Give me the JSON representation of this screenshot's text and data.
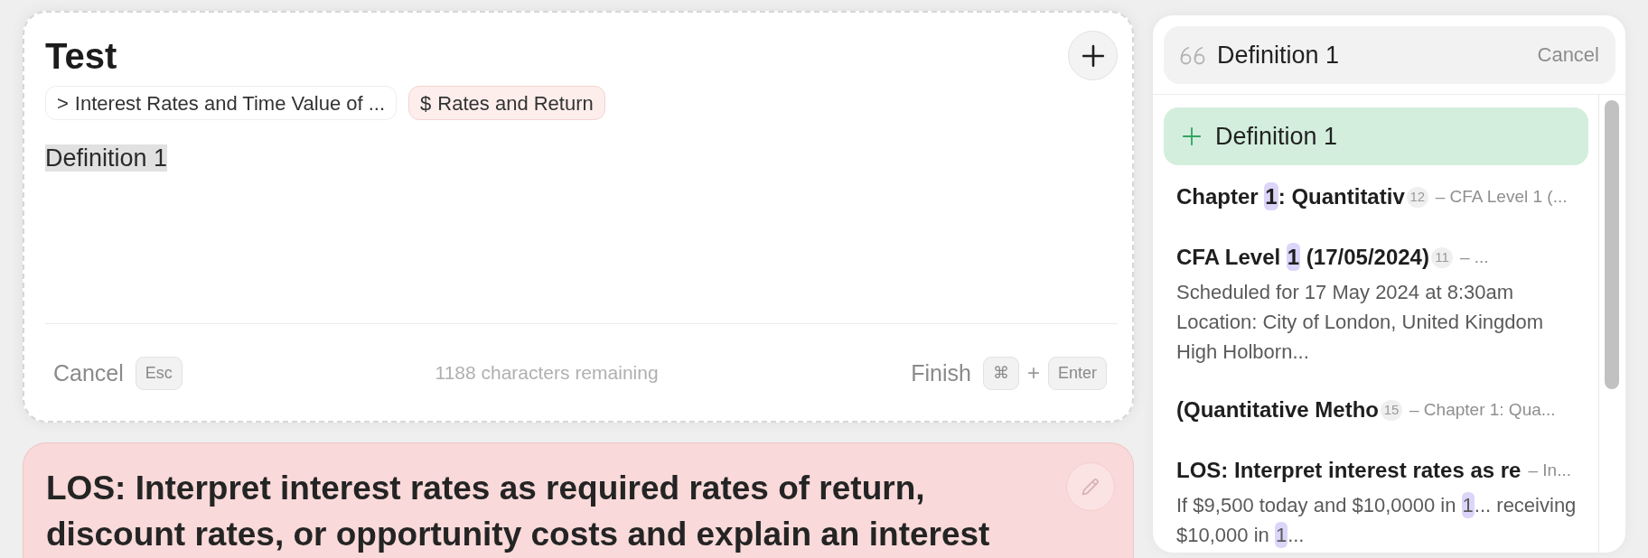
{
  "composer": {
    "title": "Test",
    "tags": [
      {
        "kind": "chapter",
        "symbol": ">",
        "label": "Interest Rates and Time Value of ..."
      },
      {
        "kind": "topic",
        "symbol": "$",
        "label": "Rates and Return"
      }
    ],
    "editor": {
      "text": "Definition 1",
      "selected": true
    },
    "footer": {
      "cancel": "Cancel",
      "cancel_key": "Esc",
      "remaining": "1188 characters remaining",
      "finish": "Finish",
      "finish_keys": [
        "⌘",
        "Enter"
      ],
      "key_joiner": "+"
    }
  },
  "los_card": {
    "text": "LOS: Interpret interest rates as required rates of return, discount rates, or opportunity costs and explain an interest"
  },
  "picker": {
    "search": {
      "value": "Definition 1",
      "cancel": "Cancel"
    },
    "options": [
      {
        "kind": "create",
        "selected": true,
        "label": "Definition 1"
      },
      {
        "kind": "result",
        "selected": false,
        "title": [
          {
            "text": "Chapter ",
            "match": false
          },
          {
            "text": "1",
            "match": true
          },
          {
            "text": ": Quantitativ",
            "match": false
          }
        ],
        "count": "12",
        "context": "– CFA Level 1 (..."
      },
      {
        "kind": "result",
        "selected": false,
        "title": [
          {
            "text": "CFA Level ",
            "match": false
          },
          {
            "text": "1",
            "match": true
          },
          {
            "text": " (17/05/2024)",
            "match": false
          }
        ],
        "count": "11",
        "context": "– ...",
        "description": [
          [
            {
              "text": "Scheduled for 17 May 2024 at 8:30am",
              "match": false
            }
          ],
          [
            {
              "text": "Location: City of London, United Kingdom",
              "match": false
            }
          ],
          [
            {
              "text": "High Holborn...",
              "match": false
            }
          ]
        ]
      },
      {
        "kind": "result",
        "selected": false,
        "title": [
          {
            "text": "(Quantitative Metho",
            "match": false
          }
        ],
        "count": "15",
        "context": "– Chapter 1: Qua..."
      },
      {
        "kind": "result",
        "selected": false,
        "title": [
          {
            "text": "LOS: Interpret interest rates as re",
            "match": false
          }
        ],
        "context": "– In...",
        "description": [
          [
            {
              "text": "If $9,500 today and $10,0000 in ",
              "match": false
            },
            {
              "text": "1",
              "match": true
            },
            {
              "text": "... receiving $10,000 in ",
              "match": false
            },
            {
              "text": "1",
              "match": true
            },
            {
              "text": "...",
              "match": false
            }
          ]
        ]
      }
    ]
  }
}
